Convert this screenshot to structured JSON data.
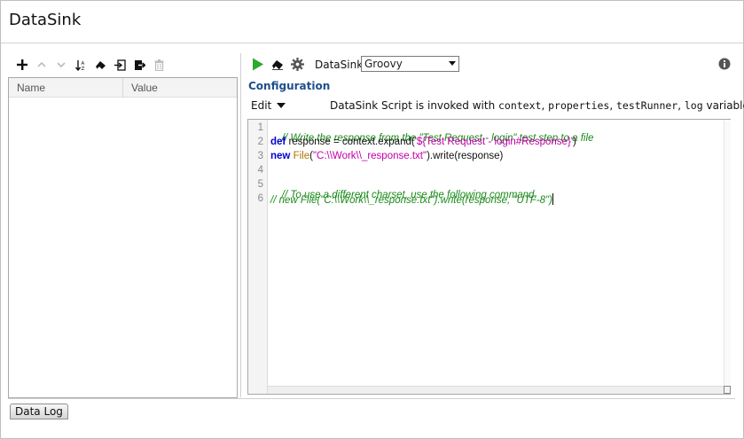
{
  "window": {
    "title": "DataSink"
  },
  "left_panel": {
    "toolbar": [
      {
        "name": "add-icon",
        "enabled": true
      },
      {
        "name": "move-up-icon",
        "enabled": false
      },
      {
        "name": "move-down-icon",
        "enabled": false
      },
      {
        "name": "sort-icon",
        "enabled": true
      },
      {
        "name": "clear-icon",
        "enabled": true
      },
      {
        "name": "import-icon",
        "enabled": true
      },
      {
        "name": "export-icon",
        "enabled": true
      },
      {
        "name": "delete-icon",
        "enabled": false
      }
    ],
    "table": {
      "columns": [
        "Name",
        "Value"
      ],
      "rows": []
    }
  },
  "right_panel": {
    "toolbar": {
      "run_icon": "play-icon",
      "clear_icon": "eraser-icon",
      "settings_icon": "gear-icon",
      "datasink_label": "DataSink:",
      "datasink_selected": "Groovy",
      "info_icon": "info-icon"
    },
    "configuration_label": "Configuration",
    "edit_menu_label": "Edit",
    "invoke_text": {
      "prefix": "DataSink Script is invoked with ",
      "var1": "context",
      "sep1": ", ",
      "var2": "properties",
      "sep2": ", ",
      "var3": "testRunner",
      "sep3": ", ",
      "var4": "log",
      "suffix": " variables"
    },
    "editor": {
      "line_numbers": [
        "1",
        "2",
        "3",
        "4",
        "5",
        "6"
      ],
      "line1": {
        "comment": "// Write the response from the \"Test Request - login\" test step to a file"
      },
      "line2": {
        "kw": "def",
        "text1": " response = context.expand(",
        "str": "'${Test Request - login#Response}'",
        "text2": ")"
      },
      "line3": {
        "kw": "new",
        "text1": " ",
        "cls": "File",
        "text2": "(",
        "str": "\"C:\\\\Work\\\\_response.txt\"",
        "text3": ").write(response)"
      },
      "line4": {
        "text": ""
      },
      "line5": {
        "comment": "// To use a different charset, use the following command."
      },
      "line6": {
        "comment": "// new File(\"C:\\\\Work\\\\_response.txt\").write(response, \"UTF-8\")"
      }
    }
  },
  "bottom_tabs": {
    "data_log": "Data Log"
  },
  "colors": {
    "accent": "#1f4f8c",
    "run_green": "#2ea82e",
    "comment_green": "#1a8a1a",
    "keyword_blue": "#0000d0",
    "string_magenta": "#c000a8",
    "class_orange": "#b07000"
  }
}
